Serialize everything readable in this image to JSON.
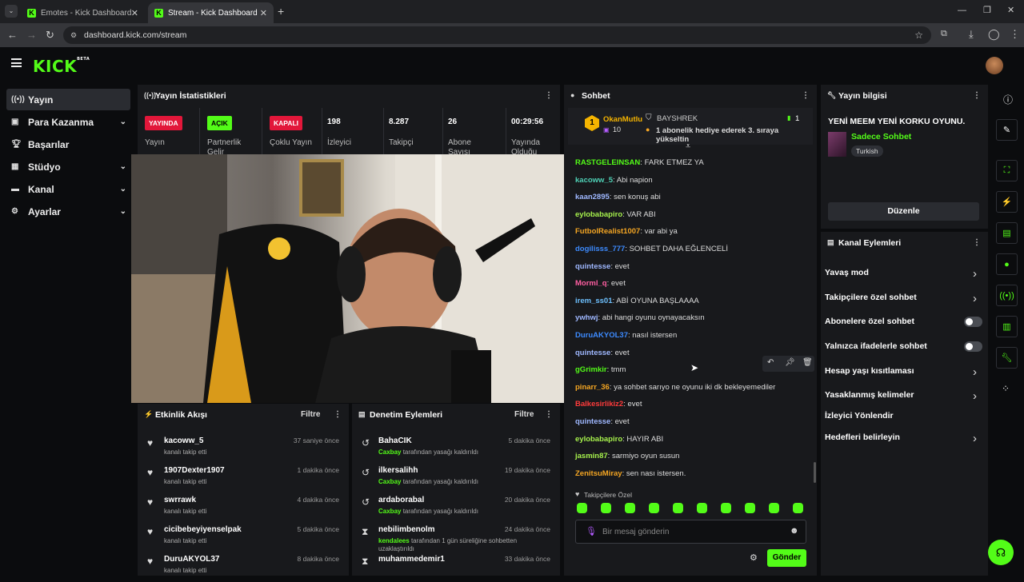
{
  "browser": {
    "tabs": [
      {
        "title": "Emotes - Kick Dashboard",
        "active": false
      },
      {
        "title": "Stream - Kick Dashboard",
        "active": true
      }
    ],
    "url": "dashboard.kick.com/stream"
  },
  "app": {
    "logo": "KICK",
    "logo_badge": "BETA"
  },
  "sidebar": {
    "items": [
      {
        "label": "Yayın",
        "icon": "broadcast-icon",
        "active": true,
        "expandable": false
      },
      {
        "label": "Para Kazanma",
        "icon": "money-icon",
        "active": false,
        "expandable": true
      },
      {
        "label": "Başarılar",
        "icon": "trophy-icon",
        "active": false,
        "expandable": false
      },
      {
        "label": "Stüdyo",
        "icon": "studio-icon",
        "active": false,
        "expandable": true
      },
      {
        "label": "Kanal",
        "icon": "channel-icon",
        "active": false,
        "expandable": true
      },
      {
        "label": "Ayarlar",
        "icon": "gear-icon",
        "active": false,
        "expandable": true
      }
    ]
  },
  "stats": {
    "title": "Yayın İstatistikleri",
    "columns": [
      {
        "badge": "YAYINDA",
        "badge_color": "#e2173a",
        "label": "Yayın"
      },
      {
        "badge": "AÇIK",
        "badge_color": "#53fc18",
        "label": "Partnerlik Gelir"
      },
      {
        "badge": "KAPALI",
        "badge_color": "#e2173a",
        "label": "Çoklu Yayın"
      },
      {
        "value": "198",
        "label": "İzleyici"
      },
      {
        "value": "8.287",
        "label": "Takipçi"
      },
      {
        "value": "26",
        "label": "Abone Sayısı"
      },
      {
        "value": "00:29:56",
        "label": "Yayında Olduğu"
      }
    ]
  },
  "activity": {
    "title": "Etkinlik Akışı",
    "filter": "Filtre",
    "items": [
      {
        "name": "kacoww_5",
        "sub": "kanalı takip etti",
        "time": "37 saniye önce"
      },
      {
        "name": "1907Dexter1907",
        "sub": "kanalı takip etti",
        "time": "1 dakika önce"
      },
      {
        "name": "swrrawk",
        "sub": "kanalı takip etti",
        "time": "4 dakika önce"
      },
      {
        "name": "cicibebeyiyenselpak",
        "sub": "kanalı takip etti",
        "time": "5 dakika önce"
      },
      {
        "name": "DuruAKYOL37",
        "sub": "kanalı takip etti",
        "time": "8 dakika önce"
      }
    ]
  },
  "moderation": {
    "title": "Denetim Eylemleri",
    "filter": "Filtre",
    "items": [
      {
        "name": "BahaCIK",
        "actor": "Caxbay",
        "sub": "tarafından yasağı kaldırıldı",
        "time": "5 dakika önce",
        "icon": "undo-icon"
      },
      {
        "name": "ilkersalihh",
        "actor": "Caxbay",
        "sub": "tarafından yasağı kaldırıldı",
        "time": "19 dakika önce",
        "icon": "undo-icon"
      },
      {
        "name": "ardaborabal",
        "actor": "Caxbay",
        "sub": "tarafından yasağı kaldırıldı",
        "time": "20 dakika önce",
        "icon": "undo-icon"
      },
      {
        "name": "nebilimbenolm",
        "actor": "kendalees",
        "sub": "tarafından 1 gün süreliğine sohbetten uzaklaştırıldı",
        "time": "24 dakika önce",
        "icon": "hourglass-icon"
      },
      {
        "name": "muhammedemir1",
        "actor": "",
        "sub": "",
        "time": "33 dakika önce",
        "icon": "hourglass-icon"
      }
    ]
  },
  "chat": {
    "title": "Sohbet",
    "pinned": {
      "rank": "1",
      "user": "OkanMutlu",
      "count": "10",
      "gifter": "BAYSHREK",
      "gift_count": "1",
      "message": "1 abonelik hediye ederek 3. sıraya yükseltin"
    },
    "messages": [
      {
        "user": "RASTGELEINSAN",
        "color": "#53fc18",
        "text": "FARK ETMEZ YA"
      },
      {
        "user": "kacoww_5",
        "color": "#4fd1b6",
        "text": "Abi napion"
      },
      {
        "user": "kaan2895",
        "color": "#9fb8ff",
        "text": "sen konuş abi"
      },
      {
        "user": "eylobabapiro",
        "color": "#a6f04c",
        "text": "VAR ABI"
      },
      {
        "user": "FutbolRealist1007",
        "color": "#f5a623",
        "text": "var abi ya"
      },
      {
        "user": "dogilisss_777",
        "color": "#3d8bff",
        "text": "SOHBET DAHA EĞLENCELİ"
      },
      {
        "user": "quintesse",
        "color": "#9fb8ff",
        "text": "evet"
      },
      {
        "user": "Morml_q",
        "color": "#ff5fa2",
        "text": "evet"
      },
      {
        "user": "irem_ss01",
        "color": "#6ec1ff",
        "text": "ABİ OYUNA BAŞLAAAA"
      },
      {
        "user": "ywhwj",
        "color": "#9fb8ff",
        "text": "abi hangi oyunu oynayacaksın"
      },
      {
        "user": "DuruAKYOL37",
        "color": "#3d8bff",
        "text": "nasıl istersen"
      },
      {
        "user": "quintesse",
        "color": "#9fb8ff",
        "text": "evet"
      },
      {
        "user": "gGrimkir",
        "color": "#53fc18",
        "text": "tmm"
      },
      {
        "user": "pinarr_36",
        "color": "#f5a623",
        "text": "ya sohbet sarıyo ne oyunu iki dk bekleyemediler"
      },
      {
        "user": "Balkesirlikiz2",
        "color": "#ff3b3b",
        "text": "evet"
      },
      {
        "user": "quintesse",
        "color": "#9fb8ff",
        "text": "evet"
      },
      {
        "user": "eylobabapiro",
        "color": "#a6f04c",
        "text": "HAYIR ABI"
      },
      {
        "user": "jasmin87",
        "color": "#a6f04c",
        "text": "sarmiyo oyun susun"
      },
      {
        "user": "ZenitsuMiray",
        "color": "#f5a623",
        "text": "sen nası istersen."
      }
    ],
    "followers_only_label": "Takipçilere Özel",
    "input_placeholder": "Bir mesaj gönderin",
    "send_label": "Gönder"
  },
  "stream_info": {
    "title": "Yayın bilgisi",
    "stream_title": "YENİ MEEM YENİ KORKU OYUNU.",
    "category": "Sadece Sohbet",
    "language": "Turkish",
    "edit_label": "Düzenle"
  },
  "channel_actions": {
    "title": "Kanal Eylemleri",
    "items": [
      {
        "label": "Yavaş mod",
        "control": "chevron"
      },
      {
        "label": "Takipçilere özel sohbet",
        "control": "chevron"
      },
      {
        "label": "Abonelere özel sohbet",
        "control": "toggle"
      },
      {
        "label": "Yalnızca ifadelerle sohbet",
        "control": "toggle"
      },
      {
        "label": "Hesap yaşı kısıtlaması",
        "control": "chevron"
      },
      {
        "label": "Yasaklanmış kelimeler",
        "control": "chevron"
      },
      {
        "label": "İzleyici Yönlendir",
        "control": "none"
      },
      {
        "label": "Hedefleri belirleyin",
        "control": "chevron"
      }
    ]
  },
  "colors": {
    "accent": "#53fc18",
    "live": "#e2173a",
    "panel": "#18191c",
    "background": "#0b0c0e"
  }
}
